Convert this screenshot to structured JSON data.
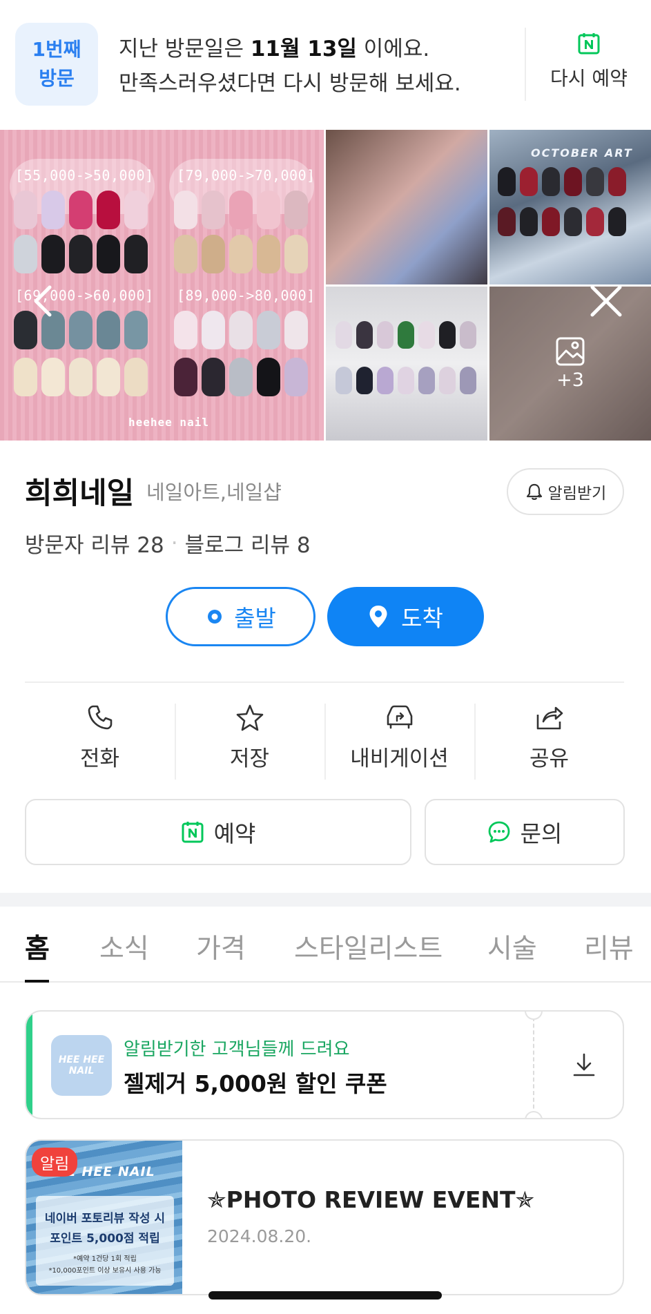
{
  "visit_banner": {
    "badge_line1": "1번째",
    "badge_line2": "방문",
    "msg_pre": "지난 방문일은 ",
    "msg_date": "11월 13일",
    "msg_post": " 이에요.",
    "msg_line2": "만족스러우셨다면 다시 방문해 보세요.",
    "rebook_label": "다시 예약",
    "naver_color": "#03c75a"
  },
  "photos": {
    "main_price_labels": [
      "[55,000->50,000]",
      "[79,000->70,000]",
      "[69,000->60,000]",
      "[89,000->80,000]"
    ],
    "main_brand": "heehee nail",
    "october_label": "OCTOBER ART",
    "more_count": "+3"
  },
  "place": {
    "name": "희희네일",
    "category": "네일아트,네일샵",
    "alarm_label": "알림받기",
    "visitor_reviews": "방문자 리뷰 28",
    "blog_reviews": "블로그 리뷰 8",
    "depart_label": "출발",
    "arrive_label": "도착",
    "accent_color": "#0f84f5"
  },
  "actions": [
    {
      "label": "전화",
      "icon": "phone-icon"
    },
    {
      "label": "저장",
      "icon": "star-icon"
    },
    {
      "label": "내비게이션",
      "icon": "navigation-car-icon"
    },
    {
      "label": "공유",
      "icon": "share-icon"
    }
  ],
  "reserve_label": "예약",
  "inquire_label": "문의",
  "tabs": [
    "홈",
    "소식",
    "가격",
    "스타일리스트",
    "시술",
    "리뷰"
  ],
  "active_tab": "홈",
  "coupon": {
    "logo_text": "HEE HEE NAIL",
    "subtitle": "알림받기한 고객님들께 드려요",
    "title": "젤제거 5,000원 할인 쿠폰",
    "accent_color": "#2fd08a"
  },
  "news": {
    "tag": "알림",
    "title": "✯PHOTO REVIEW EVENT✯",
    "date": "2024.08.20.",
    "thumb_title": "HEE HEE NAIL",
    "thumb_line1": "네이버 포토리뷰 작성 시",
    "thumb_line2": "포인트 5,000점 적립",
    "thumb_line3": "*예약 1건당 1회 적립",
    "thumb_line4": "*10,000포인트 이상 보유시 사용 가능"
  }
}
